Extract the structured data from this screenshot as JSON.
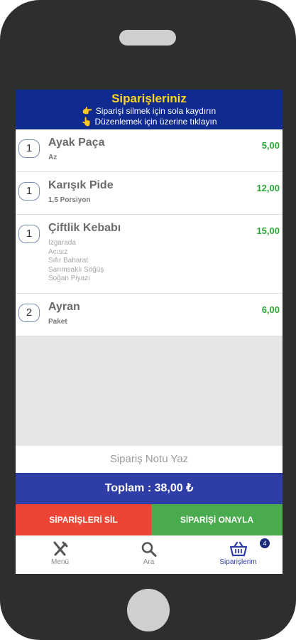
{
  "header": {
    "title": "Siparişleriniz",
    "hint_1": "Siparişi silmek için sola kaydırın",
    "hint_2": "Düzenlemek için üzerine tıklayın"
  },
  "items": [
    {
      "qty": "1",
      "name": "Ayak Paça",
      "price": "5,00",
      "options": [
        "Az"
      ]
    },
    {
      "qty": "1",
      "name": "Karışık Pide",
      "price": "12,00",
      "options": [
        "1,5 Porsiyon"
      ]
    },
    {
      "qty": "1",
      "name": "Çiftlik Kebabı",
      "price": "15,00",
      "options": [
        "Izgarada",
        "Acısız",
        "Sıfır Baharat",
        "Sarımsaklı Söğüş",
        "Soğan Piyazı"
      ]
    },
    {
      "qty": "2",
      "name": "Ayran",
      "price": "6,00",
      "options": [
        "Paket"
      ]
    }
  ],
  "note_placeholder": "Sipariş Notu Yaz",
  "total_label": "Toplam : 38,00 ₺",
  "buttons": {
    "delete": "SİPARİŞLERİ SİL",
    "confirm": "SİPARİŞİ ONAYLA"
  },
  "tabs": {
    "menu": "Menü",
    "search": "Ara",
    "orders": "Siparişlerim",
    "orders_badge": "4"
  },
  "colors": {
    "header_bg": "#0f2b8f",
    "title": "#ffd51c",
    "total_bg": "#2e3ea6",
    "delete_bg": "#ec4435",
    "confirm_bg": "#49ab4e",
    "price": "#2fa43a"
  }
}
